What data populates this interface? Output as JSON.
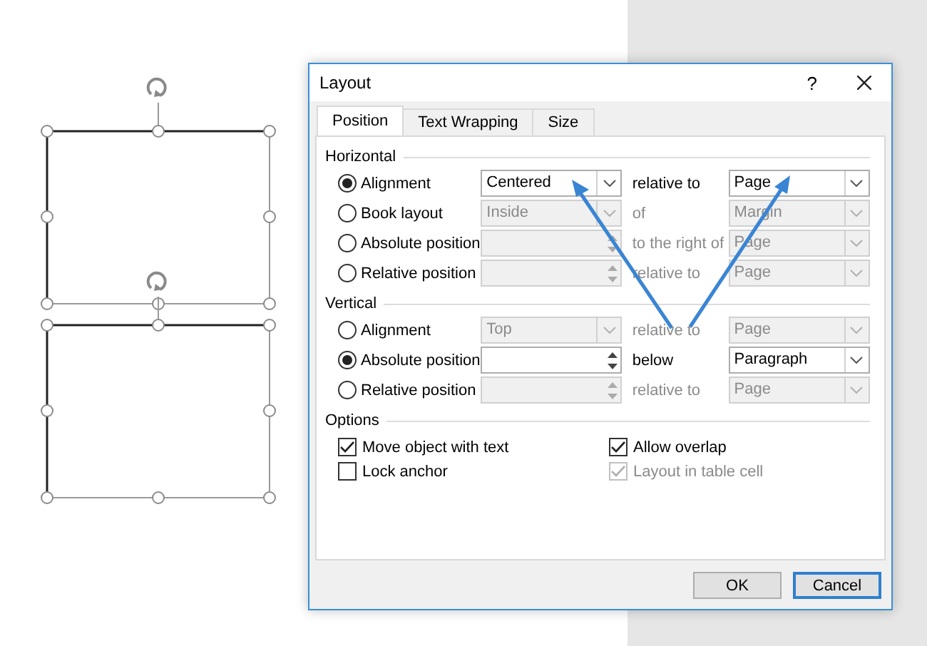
{
  "window": {
    "title": "Layout",
    "help": "?"
  },
  "tabs": [
    {
      "label": "Position",
      "selected": true
    },
    {
      "label": "Text Wrapping",
      "selected": false
    },
    {
      "label": "Size",
      "selected": false
    }
  ],
  "sections": [
    {
      "title": "Horizontal",
      "rows": [
        {
          "label": "Alignment",
          "selected": true,
          "field": {
            "kind": "dropdown",
            "value": "Centered",
            "disabled": false
          },
          "relation": {
            "text": "relative to",
            "disabled": false
          },
          "target": {
            "value": "Page",
            "disabled": false
          }
        },
        {
          "label": "Book layout",
          "selected": false,
          "field": {
            "kind": "dropdown",
            "value": "Inside",
            "disabled": true
          },
          "relation": {
            "text": "of",
            "disabled": true
          },
          "target": {
            "value": "Margin",
            "disabled": true
          }
        },
        {
          "label": "Absolute position",
          "selected": false,
          "field": {
            "kind": "spin",
            "disabled": true
          },
          "relation": {
            "text": "to the right of",
            "disabled": true
          },
          "target": {
            "value": "Page",
            "disabled": true
          }
        },
        {
          "label": "Relative position",
          "selected": false,
          "field": {
            "kind": "spin",
            "disabled": true
          },
          "relation": {
            "text": "relative to",
            "disabled": true
          },
          "target": {
            "value": "Page",
            "disabled": true
          }
        }
      ]
    },
    {
      "title": "Vertical",
      "rows": [
        {
          "label": "Alignment",
          "selected": false,
          "field": {
            "kind": "dropdown",
            "value": "Top",
            "disabled": true
          },
          "relation": {
            "text": "relative to",
            "disabled": true
          },
          "target": {
            "value": "Page",
            "disabled": true
          }
        },
        {
          "label": "Absolute position",
          "selected": true,
          "field": {
            "kind": "spin",
            "disabled": false
          },
          "relation": {
            "text": "below",
            "disabled": false
          },
          "target": {
            "value": "Paragraph",
            "disabled": false
          }
        },
        {
          "label": "Relative position",
          "selected": false,
          "field": {
            "kind": "spin",
            "disabled": true
          },
          "relation": {
            "text": "relative to",
            "disabled": true
          },
          "target": {
            "value": "Page",
            "disabled": true
          }
        }
      ]
    }
  ],
  "options": {
    "title": "Options",
    "items": [
      {
        "label": "Move object with text",
        "checked": true,
        "disabled": false
      },
      {
        "label": "Allow overlap",
        "checked": true,
        "disabled": false
      },
      {
        "label": "Lock anchor",
        "checked": false,
        "disabled": false
      },
      {
        "label": "Layout in table cell",
        "checked": true,
        "disabled": true
      }
    ]
  },
  "buttons": [
    {
      "label": "OK",
      "default": false
    },
    {
      "label": "Cancel",
      "default": true
    }
  ]
}
